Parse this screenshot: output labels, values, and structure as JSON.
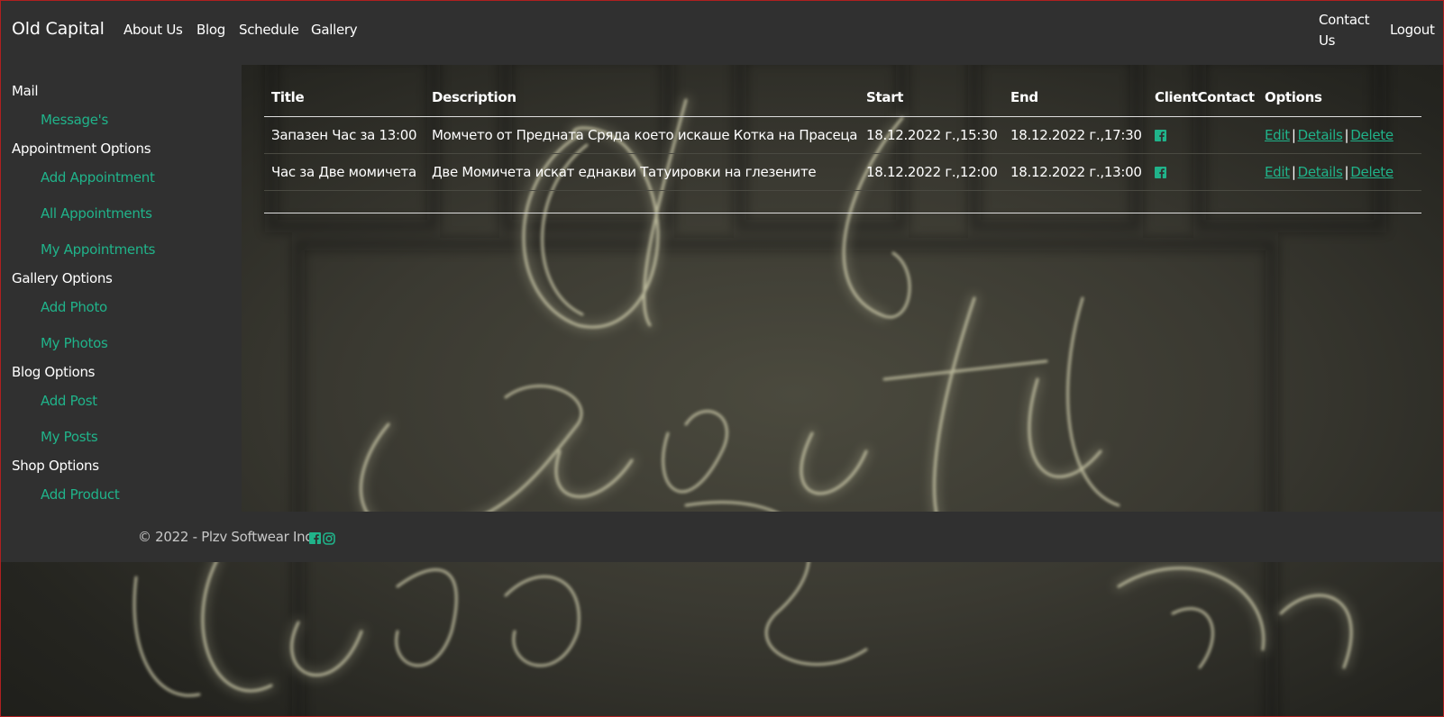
{
  "navbar": {
    "brand": "Old Capital",
    "links": [
      "About Us",
      "Blog",
      "Schedule",
      "Gallery"
    ],
    "contact_line1": "Contact",
    "contact_line2": "Us",
    "logout": "Logout"
  },
  "sidebar": {
    "mail": "Mail",
    "messages": "Message's",
    "appointment_options": "Appointment Options",
    "add_appointment": "Add Appointment",
    "all_appointments": "All Appointments",
    "my_appointments": "My Appointments",
    "gallery_options": "Gallery Options",
    "add_photo": "Add Photo",
    "my_photos": "My Photos",
    "blog_options": "Blog Options",
    "add_post": "Add Post",
    "my_posts": "My Posts",
    "shop_options": "Shop Options",
    "add_product": "Add Product"
  },
  "table": {
    "headers": {
      "title": "Title",
      "description": "Description",
      "start": "Start",
      "end": "End",
      "client_contact": "ClientContact",
      "options": "Options"
    },
    "rows": [
      {
        "title": "Запазен Час за 13:00",
        "description": "Момчето от Предната Сряда което искаше Котка на Прасеца",
        "start": "18.12.2022 г.,15:30",
        "end": "18.12.2022 г.,17:30",
        "edit": "Edit",
        "details": "Details",
        "delete": "Delete"
      },
      {
        "title": "Час за Две момичета",
        "description": "Две Момичета искат еднакви Татуировки на глезените",
        "start": "18.12.2022 г.,12:00",
        "end": "18.12.2022 г.,13:00",
        "edit": "Edit",
        "details": "Details",
        "delete": "Delete"
      }
    ],
    "separator": "|"
  },
  "footer": {
    "copyright": "© 2022 - Plzv Softwear Inc."
  },
  "colors": {
    "accent": "#20b38a",
    "panel": "#303030",
    "text": "#ffffff"
  },
  "icons": {
    "client_contact": "facebook-icon",
    "footer": [
      "facebook-icon",
      "instagram-icon"
    ]
  }
}
